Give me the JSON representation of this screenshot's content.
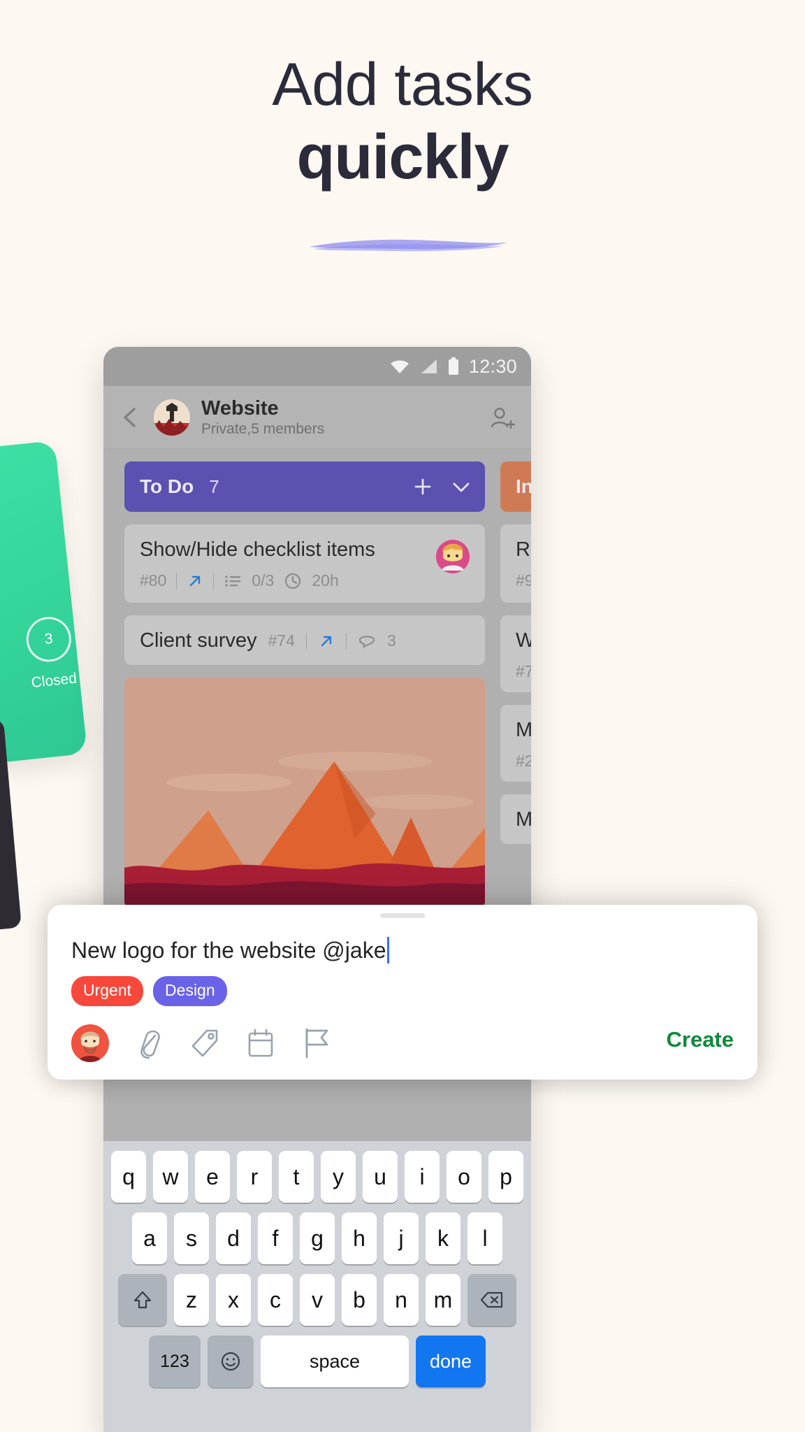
{
  "headline": {
    "line1": "Add tasks",
    "line2": "quickly",
    "underline_color": "#8d8cf0"
  },
  "left_card": {
    "count": "3",
    "label": "Closed",
    "color": "#33d39a"
  },
  "phone": {
    "status_bar": {
      "time": "12:30",
      "icons": [
        "wifi-icon",
        "signal-icon",
        "battery-icon"
      ]
    },
    "app_bar": {
      "back_icon": "chevron-left-icon",
      "title": "Website",
      "subtitle": "Private,5 members",
      "add_member_icon": "add-member-icon"
    },
    "columns": [
      {
        "name": "To Do",
        "count": "7",
        "color": "#5b51b0",
        "actions": [
          "plus-icon",
          "chevron-down-icon"
        ],
        "cards": [
          {
            "title": "Show/Hide checklist items",
            "id": "#80",
            "has_link_icon": true,
            "checklist": "0/3",
            "time": "20h",
            "has_avatar": true
          },
          {
            "title": "Client survey",
            "id": "#74",
            "has_link_icon": true,
            "comments": "3",
            "inline": true
          },
          {
            "image_card": true
          }
        ]
      },
      {
        "name": "In",
        "count": "",
        "color": "#cf7a55",
        "cards": [
          {
            "title": "Re",
            "id": "#9"
          },
          {
            "title": "W",
            "id": "#7"
          },
          {
            "title": "M",
            "id": "#2"
          },
          {
            "title": "M",
            "id": ""
          }
        ]
      }
    ]
  },
  "sheet": {
    "input_value": "New logo for the website @jake",
    "caret_color": "#3b6ef5",
    "tags": [
      {
        "label": "Urgent",
        "color": "#f7483b"
      },
      {
        "label": "Design",
        "color": "#6a63e8"
      }
    ],
    "actions": [
      {
        "name": "assignee-avatar",
        "icon": "avatar-icon"
      },
      {
        "name": "attach",
        "icon": "paperclip-icon"
      },
      {
        "name": "label",
        "icon": "tag-icon"
      },
      {
        "name": "due-date",
        "icon": "calendar-icon"
      },
      {
        "name": "priority",
        "icon": "flag-icon"
      }
    ],
    "create_label": "Create",
    "create_color": "#0e8a3c"
  },
  "keyboard": {
    "row1": [
      "q",
      "w",
      "e",
      "r",
      "t",
      "y",
      "u",
      "i",
      "o",
      "p"
    ],
    "row2": [
      "a",
      "s",
      "d",
      "f",
      "g",
      "h",
      "j",
      "k",
      "l"
    ],
    "row3": [
      "z",
      "x",
      "c",
      "v",
      "b",
      "n",
      "m"
    ],
    "shift_icon": "shift-icon",
    "backspace_icon": "backspace-icon",
    "numbers_label": "123",
    "emoji_icon": "emoji-icon",
    "space_label": "space",
    "done_label": "done"
  }
}
